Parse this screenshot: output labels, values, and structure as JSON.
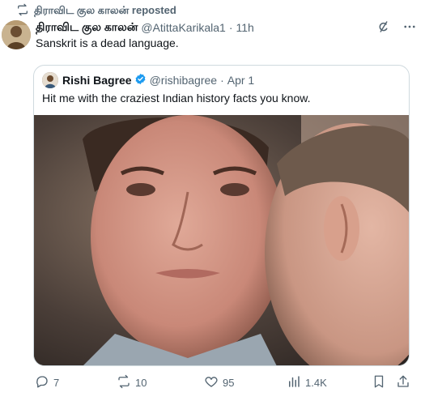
{
  "repost": {
    "label": "திராவிட குல காலன் reposted"
  },
  "tweet": {
    "author_name": "திராவிட குல காலன்",
    "handle": "@AtittaKarikala1",
    "separator": "·",
    "time": "11h",
    "text": "Sanskrit is a dead language."
  },
  "quote": {
    "author_name": "Rishi Bagree",
    "handle": "@rishibagree",
    "separator": "·",
    "date": "Apr 1",
    "text": "Hit me with the craziest Indian history facts you know."
  },
  "actions": {
    "replies": "7",
    "reposts": "10",
    "likes": "95",
    "views": "1.4K"
  },
  "icons": {
    "repost": "repost-icon",
    "grok": "grok-icon",
    "more": "more-icon",
    "verified": "verified-badge-icon",
    "reply": "reply-icon",
    "like": "heart-icon",
    "views": "views-icon",
    "bookmark": "bookmark-icon",
    "share": "share-icon"
  },
  "colors": {
    "text": "#0f1419",
    "muted": "#536471",
    "verified": "#1d9bf0",
    "border": "#cfd9de"
  }
}
